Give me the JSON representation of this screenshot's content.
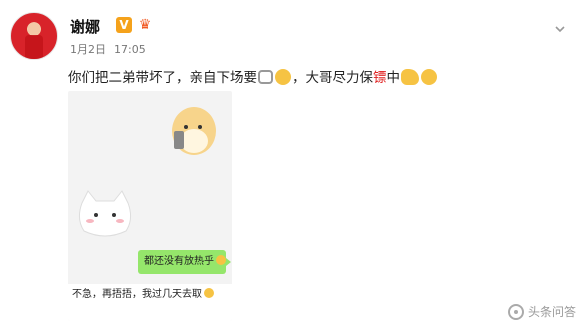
{
  "post": {
    "author": "谢娜",
    "verified_badge": "V",
    "member_icon_name": "member-crown-icon",
    "date": "1月2日",
    "time": "17:05",
    "text_part1": "你们把二弟带坏了，亲自下场要",
    "text_part2": "，大哥尽力保",
    "text_highlight": "镖",
    "text_part3": "中",
    "emojis": [
      "lock-icon",
      "worried-face-emoji",
      "strong-arm-emoji",
      "smirk-face-emoji"
    ]
  },
  "image": {
    "green_bubble": "都还没有放热乎",
    "white_bubble": "不急，再捂捂，我过几天去取"
  },
  "watermark": {
    "text": "头条问答"
  },
  "colors": {
    "highlight": "#e02020",
    "bubble_green": "#95e66b",
    "badge": "#f5a21b"
  }
}
